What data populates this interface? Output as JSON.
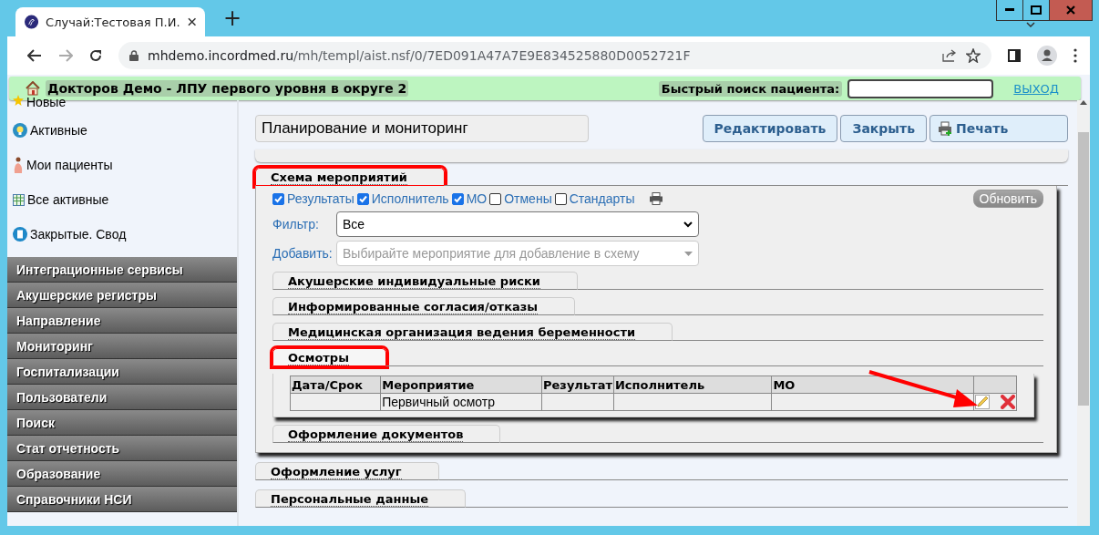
{
  "browser": {
    "tab_title": "Случай:Тестовая П.И.",
    "new_tab": "+",
    "url_host": "mhdemo.incordmed.ru",
    "url_path": "/mh/templ/aist.nsf/0/7ED091A47A7E9E834525880D0052721F"
  },
  "app_bar": {
    "org": "Докторов Демо - ЛПУ первого уровня в округе 2",
    "search_label": "Быстрый поиск пациента:",
    "logout": "ВЫХОД"
  },
  "sidebar": {
    "quick_links": [
      "Новые",
      "Активные",
      "Мои пациенты",
      "Все активные",
      "Закрытые. Свод"
    ],
    "menu": [
      "Интеграционные сервисы",
      "Акушерские регистры",
      "Направление",
      "Мониторинг",
      "Госпитализации",
      "Пользователи",
      "Поиск",
      "Стат отчетность",
      "Образование",
      "Справочники НСИ"
    ]
  },
  "header": {
    "title": "Планирование и мониторинг",
    "buttons": [
      {
        "label": "Редактировать",
        "kind": "text"
      },
      {
        "label": "Закрыть",
        "kind": "text"
      },
      {
        "label": "Печать",
        "kind": "print"
      }
    ]
  },
  "scheme": {
    "title": "Схема мероприятий",
    "highlighted": true,
    "checkboxes": [
      {
        "label": "Результаты",
        "checked": true
      },
      {
        "label": "Исполнитель",
        "checked": true
      },
      {
        "label": "МО",
        "checked": true
      },
      {
        "label": "Отмены",
        "checked": false
      },
      {
        "label": "Стандарты",
        "checked": false
      }
    ],
    "refresh": "Обновить",
    "filter": {
      "label": "Фильтр:",
      "value": "Все"
    },
    "add": {
      "label": "Добавить:",
      "placeholder": "Выбирайте мероприятие для добавление в схему"
    },
    "sections": [
      {
        "title": "Акушерские индивидуальные риски",
        "highlighted": false,
        "expanded": false
      },
      {
        "title": "Информированные согласия/отказы",
        "highlighted": false,
        "expanded": false
      },
      {
        "title": "Медицинская организация ведения беременности",
        "highlighted": false,
        "expanded": false
      },
      {
        "title": "Осмотры",
        "highlighted": true,
        "expanded": true,
        "arrow": true,
        "table": {
          "columns": [
            "Дата/Срок",
            "Мероприятие",
            "Результат",
            "Исполнитель",
            "МО"
          ],
          "rows": [
            {
              "event": "Первичный осмотр"
            }
          ]
        }
      },
      {
        "title": "Оформление документов",
        "highlighted": false,
        "expanded": false
      }
    ]
  },
  "other_sections": [
    {
      "title": "Оформление услуг"
    },
    {
      "title": "Персональные данные"
    }
  ]
}
